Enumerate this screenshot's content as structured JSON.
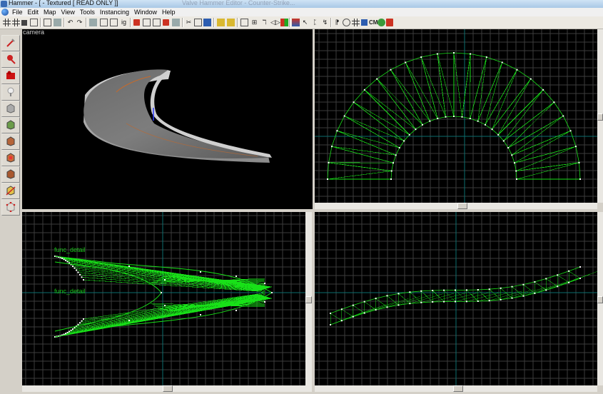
{
  "window": {
    "title": "Hammer - [ - Textured [ READ ONLY ]]",
    "faded_title_overlay": "Valve Hammer Editor - Counter-Strike..."
  },
  "menu": {
    "items": [
      "File",
      "Edit",
      "Map",
      "View",
      "Tools",
      "Instancing",
      "Window",
      "Help"
    ]
  },
  "toolbar": {
    "cm_label": "CM"
  },
  "viewports": {
    "camera": {
      "label": "camera"
    },
    "top": {
      "label": ""
    },
    "front": {
      "labels": [
        "func_detail",
        "func_detail"
      ]
    },
    "side": {
      "label": ""
    }
  },
  "colors": {
    "viewport_bg": "#000000",
    "grid_minor": "#3c3c3c",
    "grid_axis": "#0b6e6e",
    "brush_green": "#18e018",
    "vertex_white": "#ffffff",
    "chrome": "#d4d0c8"
  },
  "tools": [
    {
      "name": "selection-tool",
      "icon": "pointer-icon"
    },
    {
      "name": "magnify-tool",
      "icon": "magnify-icon"
    },
    {
      "name": "camera-tool",
      "icon": "camera-icon"
    },
    {
      "name": "entity-tool",
      "icon": "entity-icon"
    },
    {
      "name": "block-tool",
      "icon": "block-icon"
    },
    {
      "name": "texture-tool",
      "icon": "texture-icon"
    },
    {
      "name": "apply-texture-tool",
      "icon": "apply-texture-icon"
    },
    {
      "name": "decal-tool",
      "icon": "decal-icon"
    },
    {
      "name": "overlay-tool",
      "icon": "overlay-icon"
    },
    {
      "name": "clipping-tool",
      "icon": "clip-icon"
    },
    {
      "name": "vertex-tool",
      "icon": "vertex-icon"
    }
  ]
}
